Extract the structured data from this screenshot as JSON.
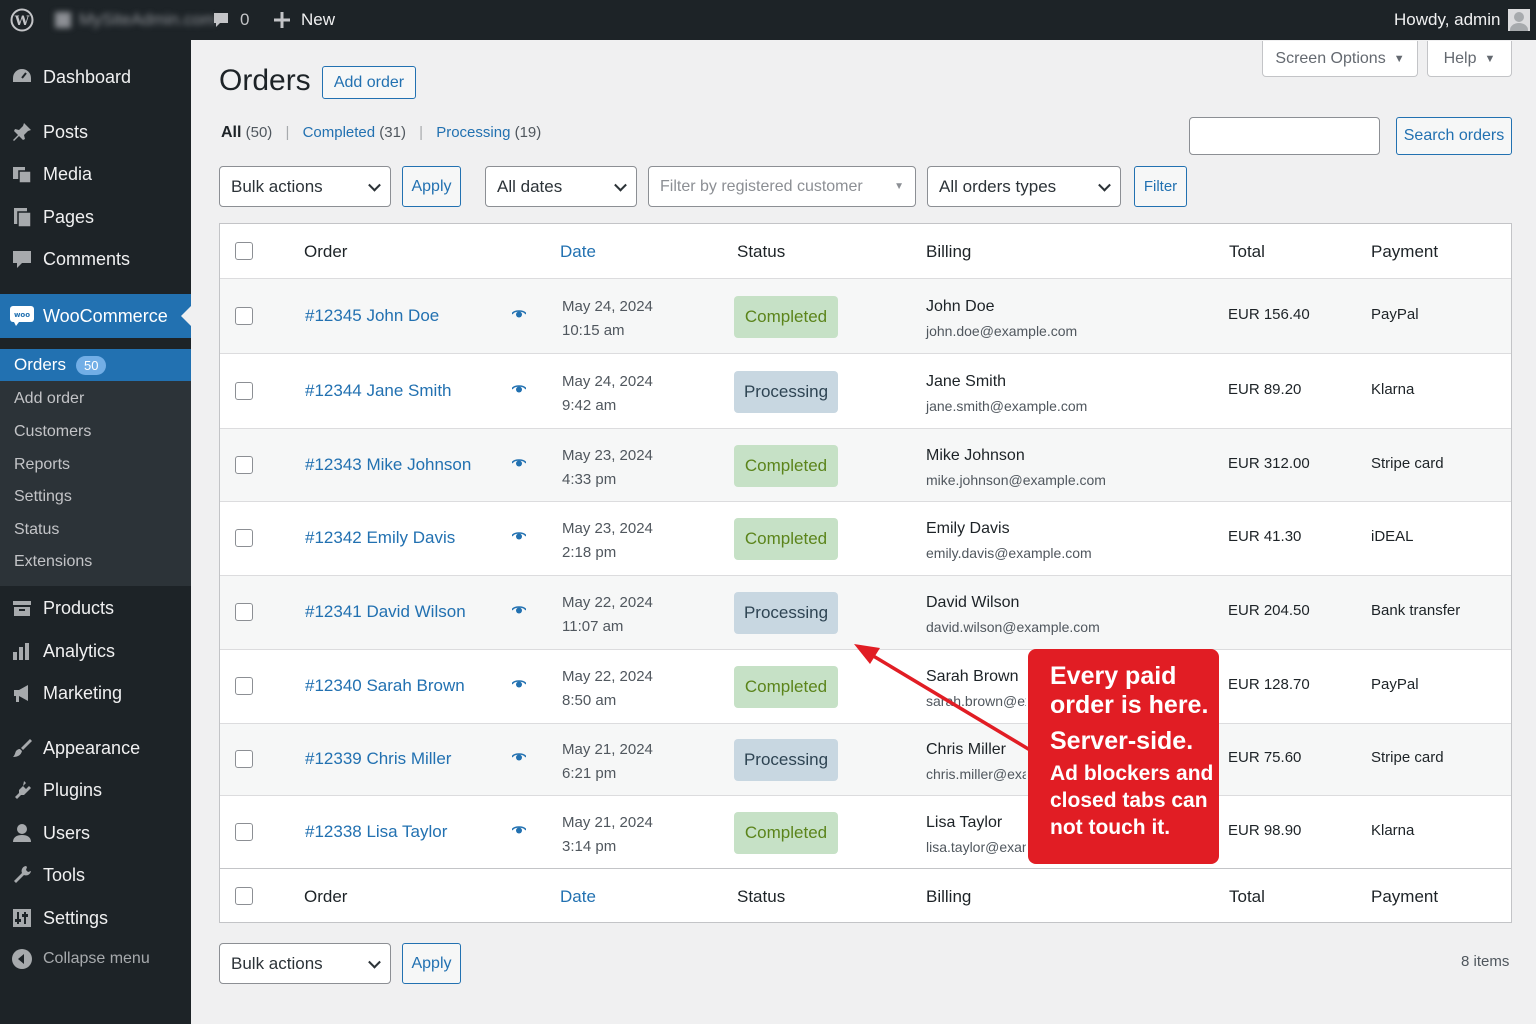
{
  "adminbar": {
    "site": "MySiteAdmin.com",
    "comments": "0",
    "new": "New",
    "howdy": "Howdy, admin"
  },
  "menu": {
    "dashboard": "Dashboard",
    "posts": "Posts",
    "media": "Media",
    "pages": "Pages",
    "comments": "Comments",
    "woocommerce": "WooCommerce",
    "sub": {
      "orders": "Orders",
      "orders_count": "50",
      "add_order": "Add order",
      "customers": "Customers",
      "reports": "Reports",
      "settings": "Settings",
      "status": "Status",
      "extensions": "Extensions"
    },
    "products": "Products",
    "analytics": "Analytics",
    "marketing": "Marketing",
    "appearance": "Appearance",
    "plugins": "Plugins",
    "users": "Users",
    "tools": "Tools",
    "settings": "Settings",
    "collapse": "Collapse menu"
  },
  "page": {
    "title": "Orders",
    "add_order": "Add order",
    "screen_options": "Screen Options",
    "help": "Help"
  },
  "views": {
    "all": "All",
    "all_count": "(50)",
    "completed": "Completed",
    "completed_count": "(31)",
    "processing": "Processing",
    "processing_count": "(19)"
  },
  "search": {
    "value": "",
    "button": "Search orders"
  },
  "filters": {
    "bulk": "Bulk actions",
    "apply": "Apply",
    "dates": "All dates",
    "customer_placeholder": "Filter by registered customer",
    "types": "All orders types",
    "filter": "Filter"
  },
  "columns": {
    "order": "Order",
    "date": "Date",
    "status": "Status",
    "billing": "Billing",
    "total": "Total",
    "payment": "Payment"
  },
  "orders": [
    {
      "order": "#12345 John Doe",
      "date": "May 24, 2024",
      "time": "10:15 am",
      "status": "Completed",
      "name": "John Doe",
      "email": "john.doe@example.com",
      "total": "EUR 156.40",
      "payment": "PayPal"
    },
    {
      "order": "#12344 Jane Smith",
      "date": "May 24, 2024",
      "time": "9:42 am",
      "status": "Processing",
      "name": "Jane Smith",
      "email": "jane.smith@example.com",
      "total": "EUR 89.20",
      "payment": "Klarna"
    },
    {
      "order": "#12343 Mike Johnson",
      "date": "May 23, 2024",
      "time": "4:33 pm",
      "status": "Completed",
      "name": "Mike Johnson",
      "email": "mike.johnson@example.com",
      "total": "EUR 312.00",
      "payment": "Stripe card"
    },
    {
      "order": "#12342 Emily Davis",
      "date": "May 23, 2024",
      "time": "2:18 pm",
      "status": "Completed",
      "name": "Emily Davis",
      "email": "emily.davis@example.com",
      "total": "EUR 41.30",
      "payment": "iDEAL"
    },
    {
      "order": "#12341 David Wilson",
      "date": "May 22, 2024",
      "time": "11:07 am",
      "status": "Processing",
      "name": "David Wilson",
      "email": "david.wilson@example.com",
      "total": "EUR 204.50",
      "payment": "Bank transfer"
    },
    {
      "order": "#12340 Sarah Brown",
      "date": "May 22, 2024",
      "time": "8:50 am",
      "status": "Completed",
      "name": "Sarah Brown",
      "email": "sarah.brown@exa",
      "total": "EUR 128.70",
      "payment": "PayPal"
    },
    {
      "order": "#12339 Chris Miller",
      "date": "May 21, 2024",
      "time": "6:21 pm",
      "status": "Processing",
      "name": "Chris Miller",
      "email": "chris.miller@exan",
      "total": "EUR 75.60",
      "payment": "Stripe card"
    },
    {
      "order": "#12338 Lisa Taylor",
      "date": "May 21, 2024",
      "time": "3:14 pm",
      "status": "Completed",
      "name": "Lisa Taylor",
      "email": "lisa.taylor@examp",
      "total": "EUR 98.90",
      "payment": "Klarna"
    }
  ],
  "footer": {
    "items": "8 items"
  },
  "callout": {
    "line1": "Every paid",
    "line2": "order is here.",
    "line3": "Server-side.",
    "line4": "Ad blockers and",
    "line5": "closed tabs can",
    "line6": "not touch it."
  },
  "colors": {
    "accent": "#2271b1",
    "completed_bg": "#c6e1c6",
    "processing_bg": "#c8d7e1",
    "callout": "#e11d24"
  }
}
